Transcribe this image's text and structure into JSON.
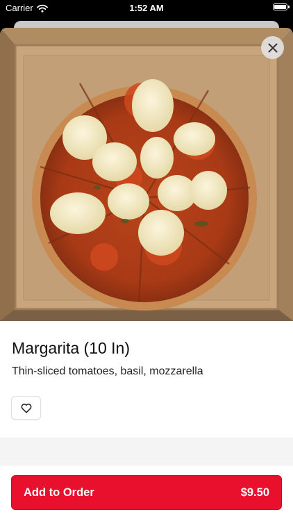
{
  "status_bar": {
    "carrier": "Carrier",
    "time": "1:52 AM"
  },
  "item": {
    "name": "Margarita (10 In)",
    "description": "Thin-sliced tomatoes, basil, mozzarella",
    "image_icon": "pizza-photo"
  },
  "actions": {
    "favorite_icon": "heart-outline-icon",
    "close_icon": "close-icon",
    "add_to_order_label": "Add to Order",
    "price": "$9.50"
  },
  "colors": {
    "accent": "#e8102c",
    "background": "#ffffff"
  }
}
